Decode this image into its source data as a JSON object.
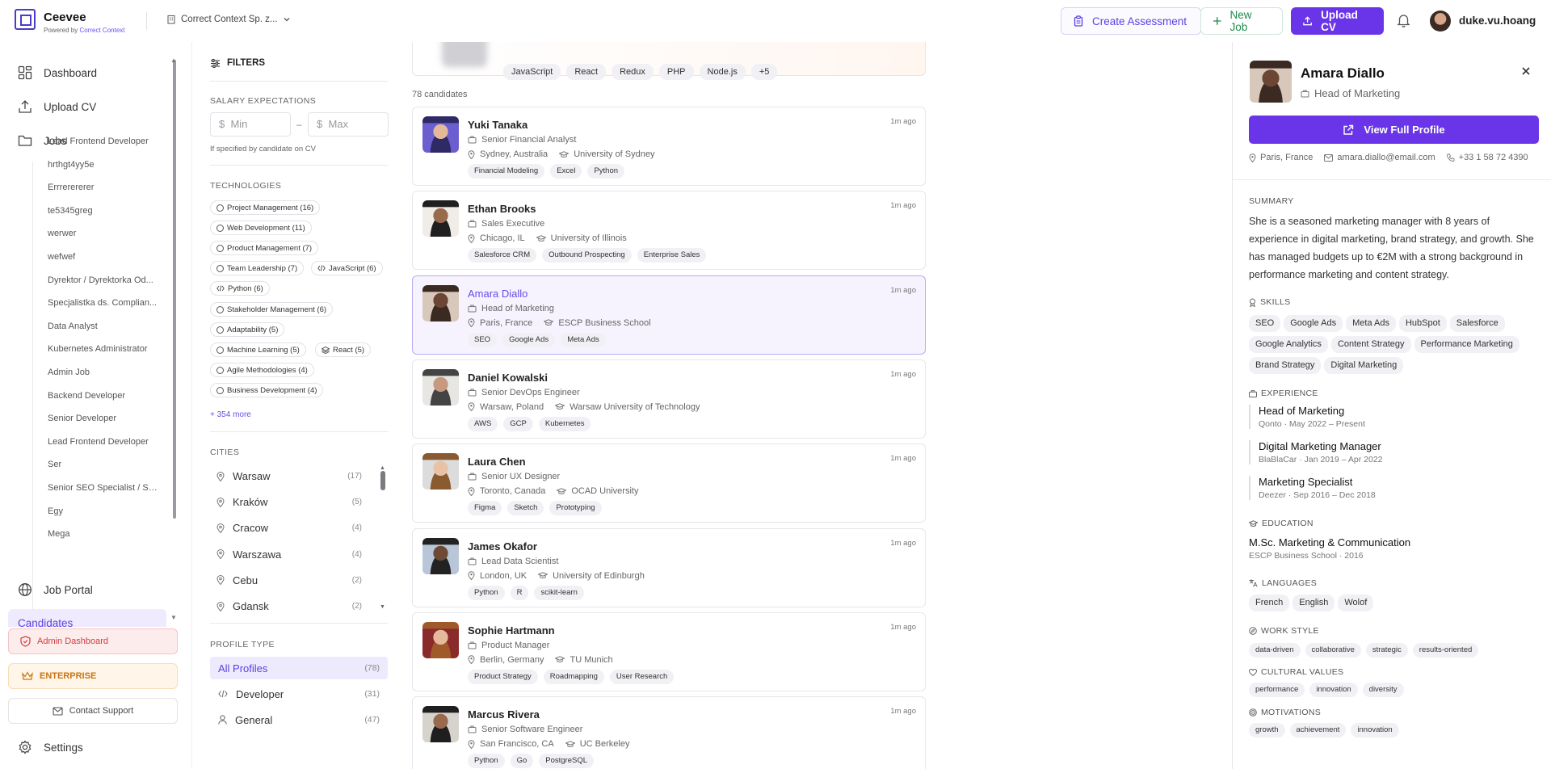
{
  "header": {
    "brand": "Ceevee",
    "powered_prefix": "Powered by",
    "powered_link": "Correct Context",
    "company": "Correct Context Sp. z...",
    "create_assessment": "Create Assessment",
    "new_job": "New Job",
    "upload_cv": "Upload CV",
    "username": "duke.vu.hoang"
  },
  "sidebar": {
    "dashboard": "Dashboard",
    "upload_cv": "Upload CV",
    "jobs": "Jobs",
    "job_items": [
      "Lead Frontend Developer",
      "hrthgt4yy5e",
      "Errrerererer",
      "te5345greg",
      "werwer",
      "wefwef",
      "Dyrektor / Dyrektorka Od...",
      "Specjalistka ds. Complian...",
      "Data Analyst",
      "Kubernetes Administrator",
      "Admin Job",
      "Backend Developer",
      "Senior Developer",
      "Lead Frontend Developer",
      "Ser",
      "Senior SEO Specialist / SE...",
      "Egy",
      "Mega"
    ],
    "job_portal": "Job Portal",
    "candidates_peek": "Candidates",
    "admin_dashboard": "Admin Dashboard",
    "enterprise": "ENTERPRISE",
    "contact_support": "Contact Support",
    "settings": "Settings"
  },
  "filters": {
    "title": "FILTERS",
    "salary_heading": "SALARY EXPECTATIONS",
    "min_placeholder": "Min",
    "max_placeholder": "Max",
    "currency": "$",
    "dash": "–",
    "salary_note": "If specified by candidate on CV",
    "tech_heading": "TECHNOLOGIES",
    "technologies": [
      {
        "label": "Project Management (16)",
        "icon": "circle"
      },
      {
        "label": "Web Development (11)",
        "icon": "circle"
      },
      {
        "label": "Product Management (7)",
        "icon": "circle"
      },
      {
        "label": "Team Leadership (7)",
        "icon": "circle"
      },
      {
        "label": "JavaScript (6)",
        "icon": "code"
      },
      {
        "label": "Python (6)",
        "icon": "code"
      },
      {
        "label": "Stakeholder Management (6)",
        "icon": "circle"
      },
      {
        "label": "Adaptability (5)",
        "icon": "circle"
      },
      {
        "label": "Machine Learning (5)",
        "icon": "circle"
      },
      {
        "label": "React (5)",
        "icon": "layers"
      },
      {
        "label": "Agile Methodologies (4)",
        "icon": "circle"
      },
      {
        "label": "Business Development (4)",
        "icon": "circle"
      }
    ],
    "more": "+ 354 more",
    "cities_heading": "CITIES",
    "cities": [
      {
        "name": "Warsaw",
        "count": "(17)"
      },
      {
        "name": "Kraków",
        "count": "(5)"
      },
      {
        "name": "Cracow",
        "count": "(4)"
      },
      {
        "name": "Warszawa",
        "count": "(4)"
      },
      {
        "name": "Cebu",
        "count": "(2)"
      },
      {
        "name": "Gdansk",
        "count": "(2)"
      }
    ],
    "profile_heading": "PROFILE TYPE",
    "profiles": [
      {
        "name": "All Profiles",
        "count": "(78)"
      },
      {
        "name": "Developer",
        "count": "(31)"
      },
      {
        "name": "General",
        "count": "(47)"
      }
    ]
  },
  "list": {
    "top_tags": [
      "JavaScript",
      "React",
      "Redux",
      "PHP",
      "Node.js",
      "+5"
    ],
    "count_label": "78 candidates",
    "candidates": [
      {
        "name": "Yuki Tanaka",
        "title": "Senior Financial Analyst",
        "location": "Sydney, Australia",
        "school": "University of Sydney",
        "ago": "1m ago",
        "tags": [
          "Financial Modeling",
          "Excel",
          "Python"
        ]
      },
      {
        "name": "Ethan Brooks",
        "title": "Sales Executive",
        "location": "Chicago, IL",
        "school": "University of Illinois",
        "ago": "1m ago",
        "tags": [
          "Salesforce CRM",
          "Outbound Prospecting",
          "Enterprise Sales"
        ]
      },
      {
        "name": "Amara Diallo",
        "title": "Head of Marketing",
        "location": "Paris, France",
        "school": "ESCP Business School",
        "ago": "1m ago",
        "tags": [
          "SEO",
          "Google Ads",
          "Meta Ads"
        ]
      },
      {
        "name": "Daniel Kowalski",
        "title": "Senior DevOps Engineer",
        "location": "Warsaw, Poland",
        "school": "Warsaw University of Technology",
        "ago": "1m ago",
        "tags": [
          "AWS",
          "GCP",
          "Kubernetes"
        ]
      },
      {
        "name": "Laura Chen",
        "title": "Senior UX Designer",
        "location": "Toronto, Canada",
        "school": "OCAD University",
        "ago": "1m ago",
        "tags": [
          "Figma",
          "Sketch",
          "Prototyping"
        ]
      },
      {
        "name": "James Okafor",
        "title": "Lead Data Scientist",
        "location": "London, UK",
        "school": "University of Edinburgh",
        "ago": "1m ago",
        "tags": [
          "Python",
          "R",
          "scikit-learn"
        ]
      },
      {
        "name": "Sophie Hartmann",
        "title": "Product Manager",
        "location": "Berlin, Germany",
        "school": "TU Munich",
        "ago": "1m ago",
        "tags": [
          "Product Strategy",
          "Roadmapping",
          "User Research"
        ]
      },
      {
        "name": "Marcus Rivera",
        "title": "Senior Software Engineer",
        "location": "San Francisco, CA",
        "school": "UC Berkeley",
        "ago": "1m ago",
        "tags": [
          "Python",
          "Go",
          "PostgreSQL"
        ]
      }
    ]
  },
  "detail": {
    "name": "Amara Diallo",
    "title": "Head of Marketing",
    "view_profile": "View Full Profile",
    "location": "Paris, France",
    "email": "amara.diallo@email.com",
    "phone": "+33 1 58 72 4390",
    "summary_heading": "SUMMARY",
    "summary": "She is a seasoned marketing manager with 8 years of experience in digital marketing, brand strategy, and growth. She has managed budgets up to €2M with a strong background in performance marketing and content strategy.",
    "skills_heading": "SKILLS",
    "skills": [
      "SEO",
      "Google Ads",
      "Meta Ads",
      "HubSpot",
      "Salesforce",
      "Google Analytics",
      "Content Strategy",
      "Performance Marketing",
      "Brand Strategy",
      "Digital Marketing"
    ],
    "experience_heading": "EXPERIENCE",
    "experience": [
      {
        "title": "Head of Marketing",
        "detail": "Qonto · May 2022 – Present"
      },
      {
        "title": "Digital Marketing Manager",
        "detail": "BlaBlaCar · Jan 2019 – Apr 2022"
      },
      {
        "title": "Marketing Specialist",
        "detail": "Deezer · Sep 2016 – Dec 2018"
      }
    ],
    "education_heading": "EDUCATION",
    "education_title": "M.Sc. Marketing & Communication",
    "education_detail": "ESCP Business School · 2016",
    "languages_heading": "LANGUAGES",
    "languages": [
      "French",
      "English",
      "Wolof"
    ],
    "work_style_heading": "WORK STYLE",
    "work_style": [
      "data-driven",
      "collaborative",
      "strategic",
      "results-oriented"
    ],
    "cultural_heading": "CULTURAL VALUES",
    "cultural": [
      "performance",
      "innovation",
      "diversity"
    ],
    "motivations_heading": "MOTIVATIONS",
    "motivations": [
      "growth",
      "achievement",
      "innovation"
    ]
  },
  "colors": {
    "accent": "#6a35e8",
    "accent_soft": "#eeeafd",
    "danger": "#d23c3c",
    "enterprise": "#c9740e",
    "success": "#1f8a4d"
  }
}
